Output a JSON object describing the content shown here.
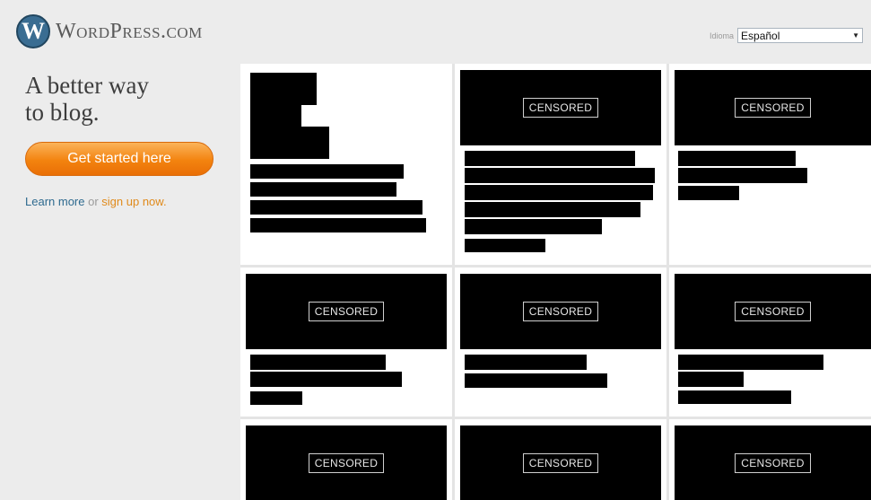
{
  "header": {
    "logo_mark": "W",
    "logo_text": "WordPress.com",
    "language_label": "Idioma",
    "language_value": "Español"
  },
  "hero": {
    "tagline_line1": "A better way",
    "tagline_line2": "to blog.",
    "cta_label": "Get started here",
    "learn_more": "Learn more",
    "or_text": " or ",
    "sign_up": "sign up now."
  },
  "grid": {
    "censored_label": "CENSORED"
  },
  "colors": {
    "accent_orange": "#f3830f",
    "link_blue": "#2e6a8f",
    "wp_blue": "#3a6d92"
  }
}
